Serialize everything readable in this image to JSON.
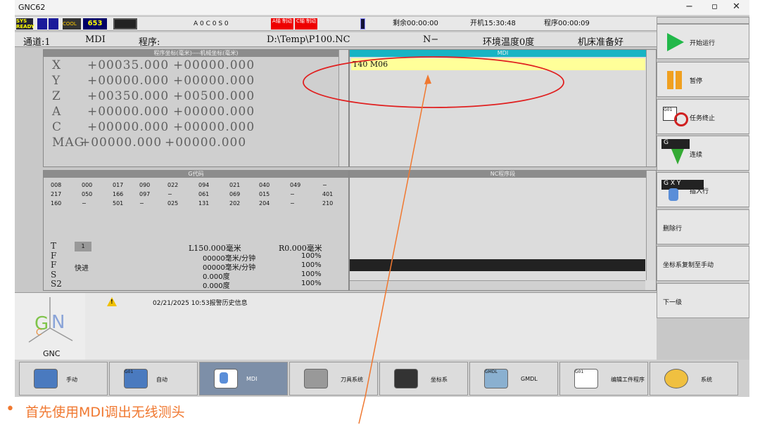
{
  "window": {
    "title": "GNC62",
    "min": "−",
    "max": "▫",
    "close": "✕"
  },
  "status": {
    "sys_ready": "SYS READY",
    "badge_num": "653",
    "axes_status": "A 0  C 0  S 0",
    "a_alarm": "A轴 制动",
    "c_alarm": "C轴 制动",
    "remain": "剩余00:00:00",
    "power_on": "开机15:30:48",
    "program_time": "程序00:00:09"
  },
  "info": {
    "channel": "通道:1",
    "mode": "MDI",
    "program_label": "程序:",
    "program_path": "D:\\Temp\\P100.NC",
    "n_value": "N−",
    "temp": "环境温度0度",
    "machine_state": "机床准备好"
  },
  "coords": {
    "header": "程序坐标(毫米)----机械坐标(毫米)",
    "rows": [
      {
        "axis": "X",
        "prog": "+00035.000",
        "mach": "+00000.000"
      },
      {
        "axis": "Y",
        "prog": "+00000.000",
        "mach": "+00000.000"
      },
      {
        "axis": "Z",
        "prog": "+00350.000",
        "mach": "+00500.000"
      },
      {
        "axis": "A",
        "prog": "+00000.000",
        "mach": "+00000.000"
      },
      {
        "axis": "C",
        "prog": "+00000.000",
        "mach": "+00000.000"
      },
      {
        "axis": "MAG",
        "prog": "+00000.000",
        "mach": "+00000.000"
      }
    ]
  },
  "mdi": {
    "header": "MDI",
    "line": "T40 M06"
  },
  "gcode": {
    "header": "G代码",
    "rows": [
      [
        "008",
        "000",
        "017",
        "090",
        "022",
        "094",
        "021",
        "040",
        "049",
        "−",
        ""
      ],
      [
        "217",
        "050",
        "166",
        "097",
        "−",
        "061",
        "069",
        "015",
        "−",
        "401"
      ],
      [
        "160",
        "−",
        "501",
        "−",
        "025",
        "131",
        "202",
        "204",
        "−",
        "210"
      ]
    ]
  },
  "ncprog": {
    "header": "NC程序段"
  },
  "tool": {
    "t_label": "T",
    "t_value": "1",
    "f1_label": "F",
    "f2_label": "F",
    "f2_text": "快进",
    "s_label": "S",
    "s2_label": "S2",
    "l_value": "L150.000毫米",
    "r_value": "R0.000毫米",
    "rows": [
      {
        "v": "00000毫米/分钟",
        "p": "100%"
      },
      {
        "v": "00000毫米/分钟",
        "p": "100%"
      },
      {
        "v": "0.000度",
        "p": "100%"
      },
      {
        "v": "0.000度",
        "p": "100%"
      }
    ]
  },
  "alarm": {
    "text": "02/21/2025 10:53报警历史信息",
    "warn": "!"
  },
  "logo": {
    "text": "GNC"
  },
  "right_buttons": [
    "开始运行",
    "暂停",
    "任务终止",
    "连续",
    "插入行",
    "删除行",
    "坐标系复制至手动",
    "下一级"
  ],
  "icon_text": {
    "g01": "G01",
    "xf": "X\nF",
    "g": "G",
    "gxy": "G X Y",
    "z": "Z",
    "y": "Y",
    "x": "X",
    "gmdl": "GMDL"
  },
  "bottom_buttons": [
    "手动",
    "自动",
    "MDI",
    "刀具系统",
    "坐标系",
    "GMDL",
    "编辑工件程序",
    "系统"
  ],
  "annotation": {
    "caption": "首先使用MDI调出无线测头",
    "bullet": "•"
  },
  "colors": {
    "accent": "#f07830",
    "alarm": "#ff0000",
    "mdi_line": "#ffff99",
    "teal": "#17b4c4",
    "play": "#22b84a",
    "pause": "#f0a020"
  }
}
